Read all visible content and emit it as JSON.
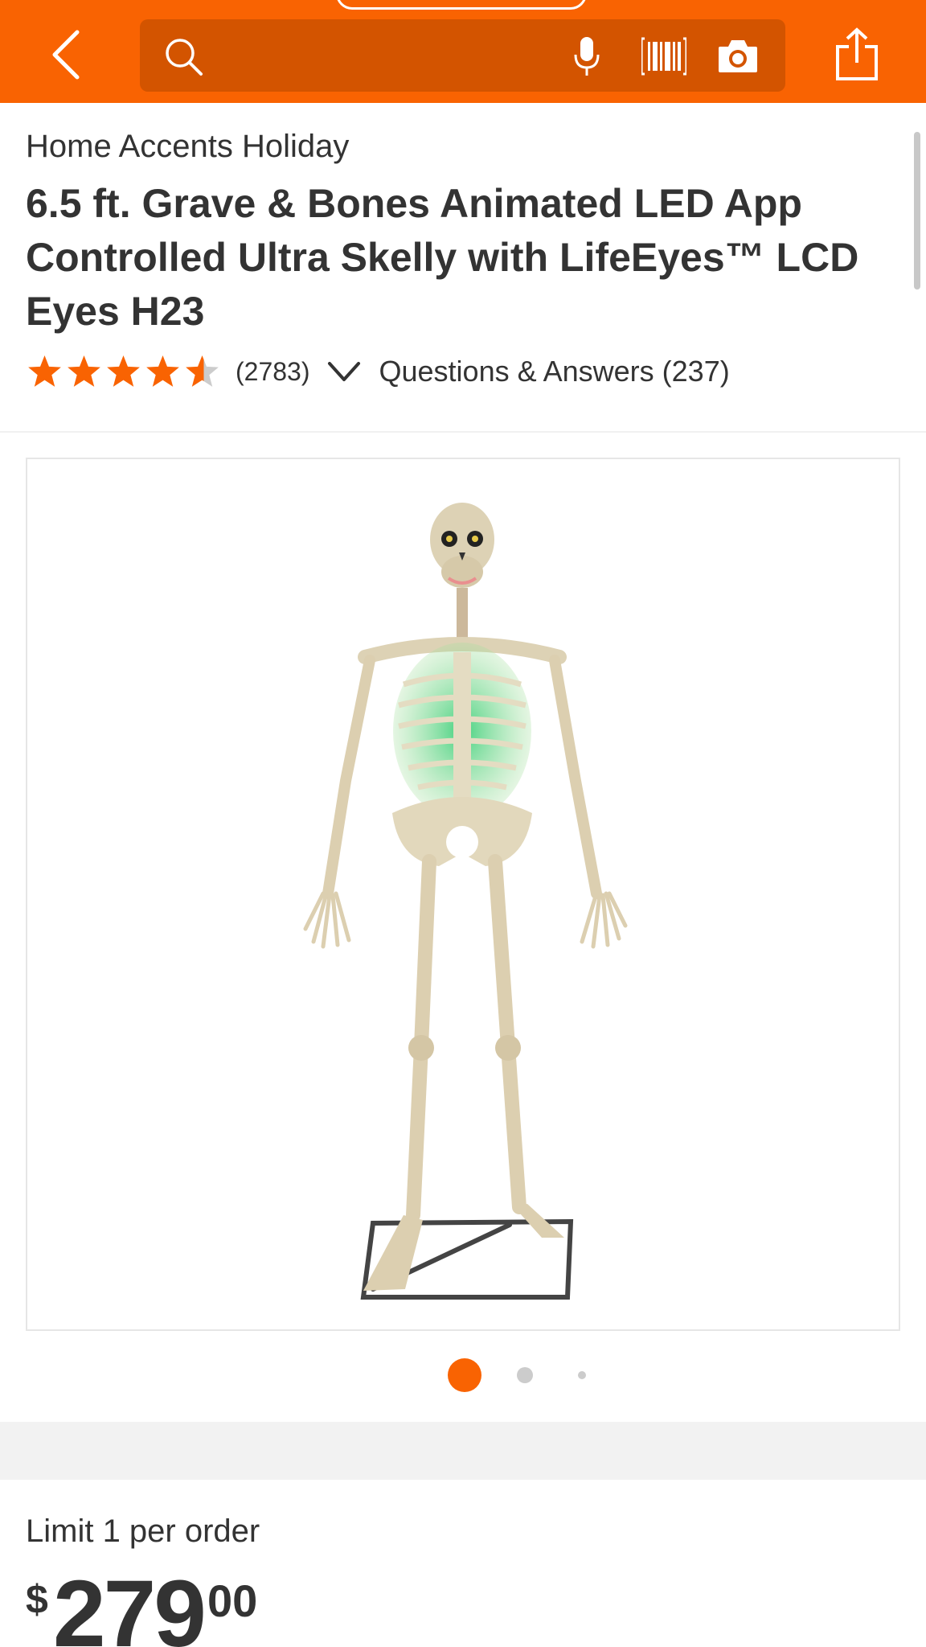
{
  "header": {
    "search_placeholder": "",
    "accent_color": "#f96302",
    "search_bg_color": "#d35400"
  },
  "product": {
    "brand": "Home Accents Holiday",
    "title": "6.5 ft. Grave & Bones Animated LED App Controlled Ultra Skelly with LifeEyes™ LCD Eyes H23",
    "rating": 4.5,
    "review_count": "(2783)",
    "qa_label": "Questions & Answers (237)",
    "image_icon": "skeleton-product-image",
    "carousel": {
      "total": 3,
      "active": 1
    },
    "limit_text": "Limit 1 per order",
    "price": {
      "currency": "$",
      "dollars": "279",
      "cents": "00"
    }
  },
  "icons": {
    "back": "back-arrow-icon",
    "search": "search-icon",
    "mic": "microphone-icon",
    "barcode": "barcode-scanner-icon",
    "camera": "camera-icon",
    "share": "share-icon",
    "next": "chevron-right-icon",
    "expand": "chevron-down-icon"
  }
}
